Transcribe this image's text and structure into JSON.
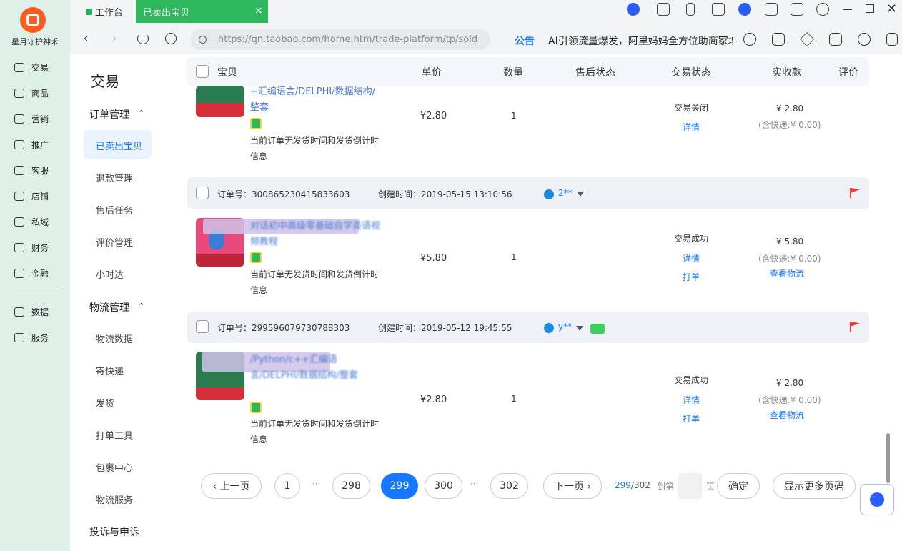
{
  "rail": {
    "shop_name": "星月守护神禾",
    "items": [
      "交易",
      "商品",
      "营销",
      "推广",
      "客服",
      "店铺",
      "私域",
      "财务",
      "金融",
      "数据",
      "服务"
    ]
  },
  "tabs": {
    "workbench": "工作台",
    "active": "已卖出宝贝",
    "close": "×"
  },
  "address": {
    "back": "‹",
    "forward": "›",
    "url": "https://qn.taobao.com/home.htm/trade-platform/tp/sold",
    "notice_label": "公告",
    "notice_text": "AI引领流量爆发，阿里妈妈全方位助商家增长"
  },
  "subnav": {
    "title": "交易",
    "group_order": "订单管理",
    "group_logistics": "物流管理",
    "group_complaint": "投诉与申诉",
    "caret": "⌃",
    "order_items": [
      "已卖出宝贝",
      "退款管理",
      "售后任务",
      "评价管理",
      "小时达"
    ],
    "logistics_items": [
      "物流数据",
      "寄快递",
      "发货",
      "打单工具",
      "包裹中心",
      "物流服务"
    ]
  },
  "table_header": {
    "item": "宝贝",
    "unit_price": "单价",
    "quantity": "数量",
    "after_sale": "售后状态",
    "trade_status": "交易状态",
    "paid": "实收款",
    "review": "评价"
  },
  "labels": {
    "order_no": "订单号：",
    "created": "创建时间：",
    "note": "当前订单无发货时间和发货倒计时信息",
    "detail": "详情",
    "print": "打单",
    "logistics": "查看物流"
  },
  "orders": [
    {
      "title": "+汇编语言/DELPHI/数据结构/整套",
      "price": "¥2.80",
      "qty": "1",
      "status": "交易关闭",
      "paid": "¥ 2.80",
      "paid_sub": "(含快递:¥ 0.00)"
    },
    {
      "order_no": "300865230415833603",
      "created": "2019-05-15 13:10:56",
      "buyer": "2**",
      "title": "对话初中高级零基础自学英语视频教程",
      "price": "¥5.80",
      "qty": "1",
      "status": "交易成功",
      "paid": "¥ 5.80",
      "paid_sub": "(含快递:¥ 0.00)"
    },
    {
      "order_no": "299596079730788303",
      "created": "2019-05-12 19:45:55",
      "buyer": "y**",
      "title": "/Python/c++汇编语言/DELPHI/数据结构/整套",
      "price": "¥2.80",
      "qty": "1",
      "status": "交易成功",
      "paid": "¥ 2.80",
      "paid_sub": "(含快递:¥ 0.00)"
    }
  ],
  "pager": {
    "prev": "‹ 上一页",
    "next": "下一页 ›",
    "pages": [
      "1",
      "298",
      "299",
      "300",
      "302"
    ],
    "dots": "···",
    "current": "299",
    "total": "/302",
    "goto": "到第",
    "page_unit": "页",
    "confirm": "确定",
    "more": "显示更多页码"
  },
  "colors": {
    "accent": "#1677ff",
    "brand_green": "#2db85e",
    "flag_red": "#e8423b"
  }
}
